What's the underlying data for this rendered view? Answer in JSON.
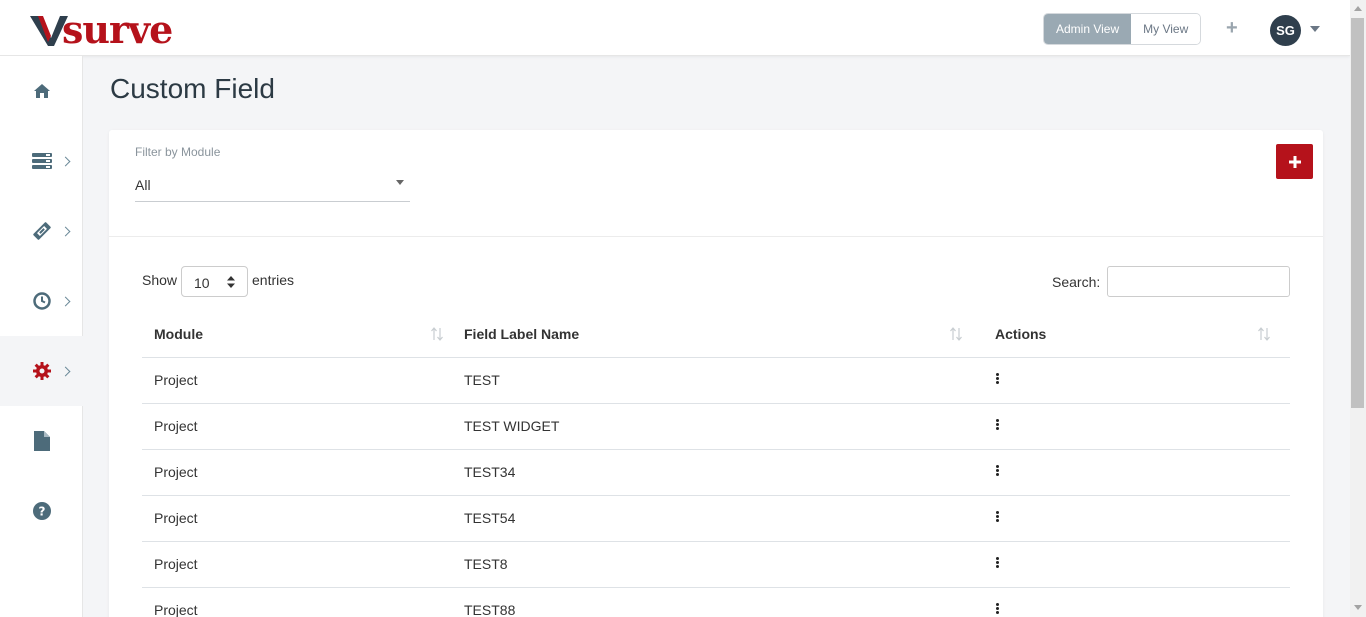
{
  "header": {
    "logo_text": "surve",
    "admin_view_label": "Admin View",
    "my_view_label": "My View",
    "add_symbol": "+",
    "avatar_initials": "SG"
  },
  "sidebar": {
    "items": [
      {
        "icon": "home-icon",
        "has_submenu": false
      },
      {
        "icon": "server-icon",
        "has_submenu": true
      },
      {
        "icon": "ticket-icon",
        "has_submenu": true
      },
      {
        "icon": "clock-icon",
        "has_submenu": true
      },
      {
        "icon": "gear-icon",
        "has_submenu": true,
        "active": true
      },
      {
        "icon": "file-icon",
        "has_submenu": false
      },
      {
        "icon": "help-icon",
        "has_submenu": false
      }
    ]
  },
  "page": {
    "title": "Custom Field"
  },
  "filter": {
    "label": "Filter by Module",
    "value": "All"
  },
  "table_controls": {
    "show_label": "Show",
    "page_length": "10",
    "entries_label": "entries",
    "search_label": "Search:",
    "search_value": ""
  },
  "table": {
    "columns": [
      "Module",
      "Field Label Name",
      "Actions"
    ],
    "rows": [
      {
        "module": "Project",
        "field_label": "TEST"
      },
      {
        "module": "Project",
        "field_label": "TEST WIDGET"
      },
      {
        "module": "Project",
        "field_label": "TEST34"
      },
      {
        "module": "Project",
        "field_label": "TEST54"
      },
      {
        "module": "Project",
        "field_label": "TEST8"
      },
      {
        "module": "Project",
        "field_label": "TEST88"
      }
    ]
  },
  "colors": {
    "brand_red": "#b5121b",
    "icon_slate": "#4d6b7a",
    "active_toggle": "#9aa9b3"
  }
}
